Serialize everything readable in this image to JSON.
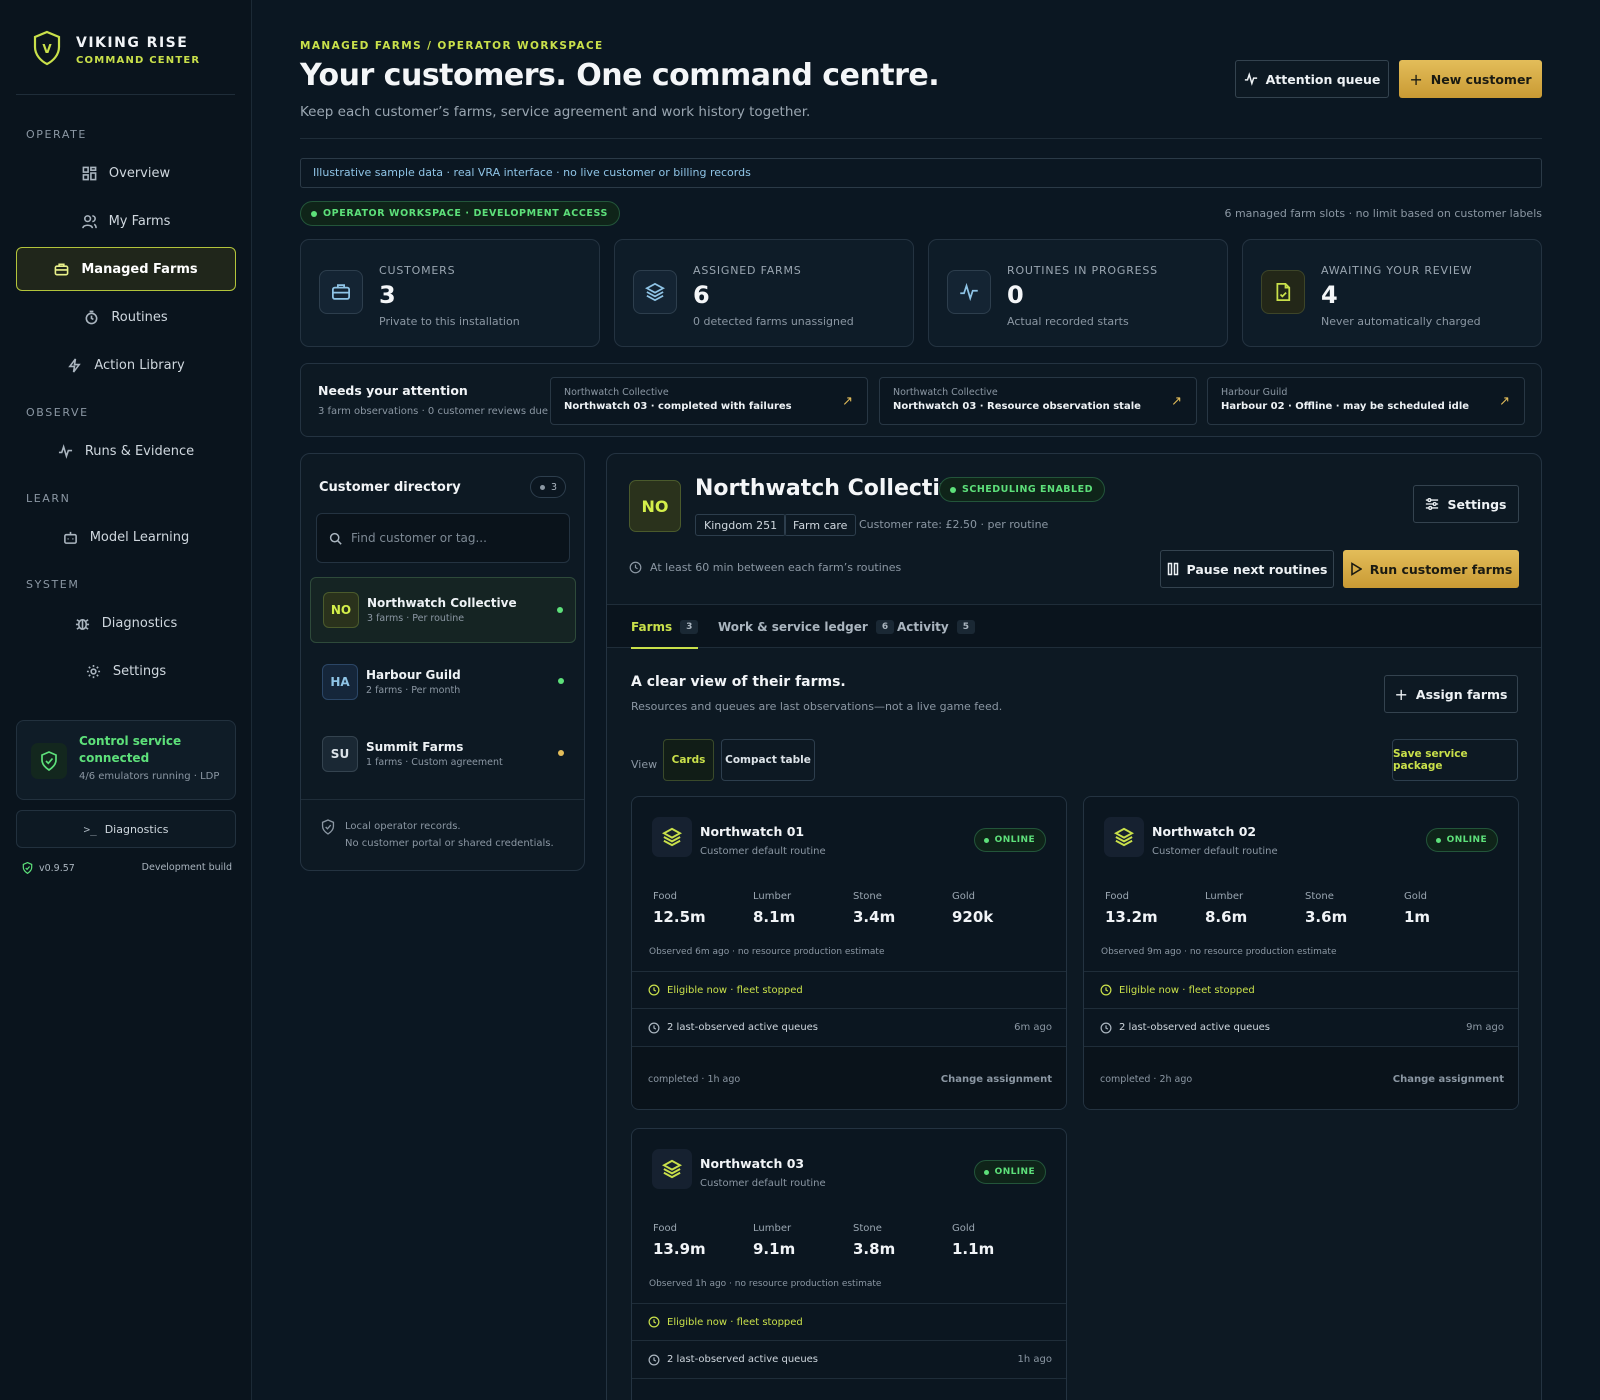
{
  "brand": {
    "title": "VIKING RISE",
    "subtitle": "COMMAND CENTER",
    "logo_letter": "V"
  },
  "nav": {
    "sections": {
      "operate": "OPERATE",
      "observe": "OBSERVE",
      "learn": "LEARN",
      "system": "SYSTEM"
    },
    "items": {
      "overview": "Overview",
      "my_farms": "My Farms",
      "managed_farms": "Managed Farms",
      "routines": "Routines",
      "action_library": "Action Library",
      "runs_evidence": "Runs & Evidence",
      "model_learning": "Model Learning",
      "diagnostics": "Diagnostics",
      "settings": "Settings"
    }
  },
  "service": {
    "title": "Control service connected",
    "status": "4/6 emulators running · LDPl..."
  },
  "diag_button": "Diagnostics",
  "version": {
    "number": "v0.9.57",
    "build": "Development build"
  },
  "header": {
    "eyebrow": "MANAGED FARMS / OPERATOR WORKSPACE",
    "title": "Your customers. One command centre.",
    "subtitle": "Keep each customer’s farms, service agreement and work history together.",
    "attention_btn": "Attention queue",
    "new_customer_btn": "New customer"
  },
  "sample_notice": "Illustrative sample data · real VRA interface · no live customer or billing records",
  "workspace_pill": "OPERATOR WORKSPACE · DEVELOPMENT ACCESS",
  "slots_note": "6 managed farm slots · no limit based on customer labels",
  "stats": [
    {
      "label": "CUSTOMERS",
      "value": "3",
      "sub": "Private to this installation",
      "icon": "briefcase-icon"
    },
    {
      "label": "ASSIGNED FARMS",
      "value": "6",
      "sub": "0 detected farms unassigned",
      "icon": "layers-icon"
    },
    {
      "label": "ROUTINES IN PROGRESS",
      "value": "0",
      "sub": "Actual recorded starts",
      "icon": "pulse-icon"
    },
    {
      "label": "AWAITING YOUR REVIEW",
      "value": "4",
      "sub": "Never automatically charged",
      "icon": "document-check-icon"
    }
  ],
  "attention": {
    "title": "Needs your attention",
    "sub": "3 farm observations · 0 customer reviews due",
    "items": [
      {
        "customer": "Northwatch Collective",
        "text": "Northwatch 03 · completed with failures"
      },
      {
        "customer": "Northwatch Collective",
        "text": "Northwatch 03 · Resource observation stale"
      },
      {
        "customer": "Harbour Guild",
        "text": "Harbour 02 · Offline · may be scheduled idle"
      }
    ]
  },
  "directory": {
    "title": "Customer directory",
    "count": "3",
    "search_placeholder": "Find customer or tag...",
    "customers": [
      {
        "initials": "NO",
        "name": "Northwatch Collective",
        "sub": "3 farms · Per routine"
      },
      {
        "initials": "HA",
        "name": "Harbour Guild",
        "sub": "2 farms · Per month"
      },
      {
        "initials": "SU",
        "name": "Summit Farms",
        "sub": "1 farms · Custom agreement"
      }
    ],
    "footer_line1": "Local operator records.",
    "footer_line2": "No customer portal or shared credentials."
  },
  "detail": {
    "initials": "NO",
    "name": "Northwatch Collective",
    "status": "SCHEDULING ENABLED",
    "tags": [
      "Kingdom 251",
      "Farm care"
    ],
    "rate": "Customer rate: £2.50 · per routine",
    "settings_btn": "Settings",
    "gap_note": "At least 60 min between each farm’s routines",
    "pause_btn": "Pause next routines",
    "run_btn": "Run customer farms",
    "tabs": [
      {
        "label": "Farms",
        "count": "3"
      },
      {
        "label": "Work & service ledger",
        "count": "6"
      },
      {
        "label": "Activity",
        "count": "5"
      }
    ],
    "section_title": "A clear view of their farms.",
    "section_sub": "Resources and queues are last observations—not a live game feed.",
    "assign_btn": "Assign farms",
    "view_label": "View",
    "view_cards": "Cards",
    "view_table": "Compact table",
    "save_package": "Save service package"
  },
  "resource_labels": {
    "food": "Food",
    "lumber": "Lumber",
    "stone": "Stone",
    "gold": "Gold"
  },
  "farms": [
    {
      "name": "Northwatch 01",
      "routine": "Customer default routine",
      "status": "ONLINE",
      "food": "12.5m",
      "lumber": "8.1m",
      "stone": "3.4m",
      "gold": "920k",
      "observed": "Observed 6m ago · no resource production estimate",
      "eligible": "Eligible now · fleet stopped",
      "queues": "2 last-observed active queues",
      "queues_time": "6m ago",
      "last_run": "completed · 1h ago",
      "change": "Change assignment"
    },
    {
      "name": "Northwatch 02",
      "routine": "Customer default routine",
      "status": "ONLINE",
      "food": "13.2m",
      "lumber": "8.6m",
      "stone": "3.6m",
      "gold": "1m",
      "observed": "Observed 9m ago · no resource production estimate",
      "eligible": "Eligible now · fleet stopped",
      "queues": "2 last-observed active queues",
      "queues_time": "9m ago",
      "last_run": "completed · 2h ago",
      "change": "Change assignment"
    },
    {
      "name": "Northwatch 03",
      "routine": "Customer default routine",
      "status": "ONLINE",
      "food": "13.9m",
      "lumber": "9.1m",
      "stone": "3.8m",
      "gold": "1.1m",
      "observed": "Observed 1h ago · no resource production estimate",
      "eligible": "Eligible now · fleet stopped",
      "queues": "2 last-observed active queues",
      "queues_time": "1h ago"
    }
  ],
  "colors": {
    "accent": "#c9e04a",
    "gold": "#e3bd5a",
    "online": "#5de07a",
    "background": "#0b1722"
  }
}
